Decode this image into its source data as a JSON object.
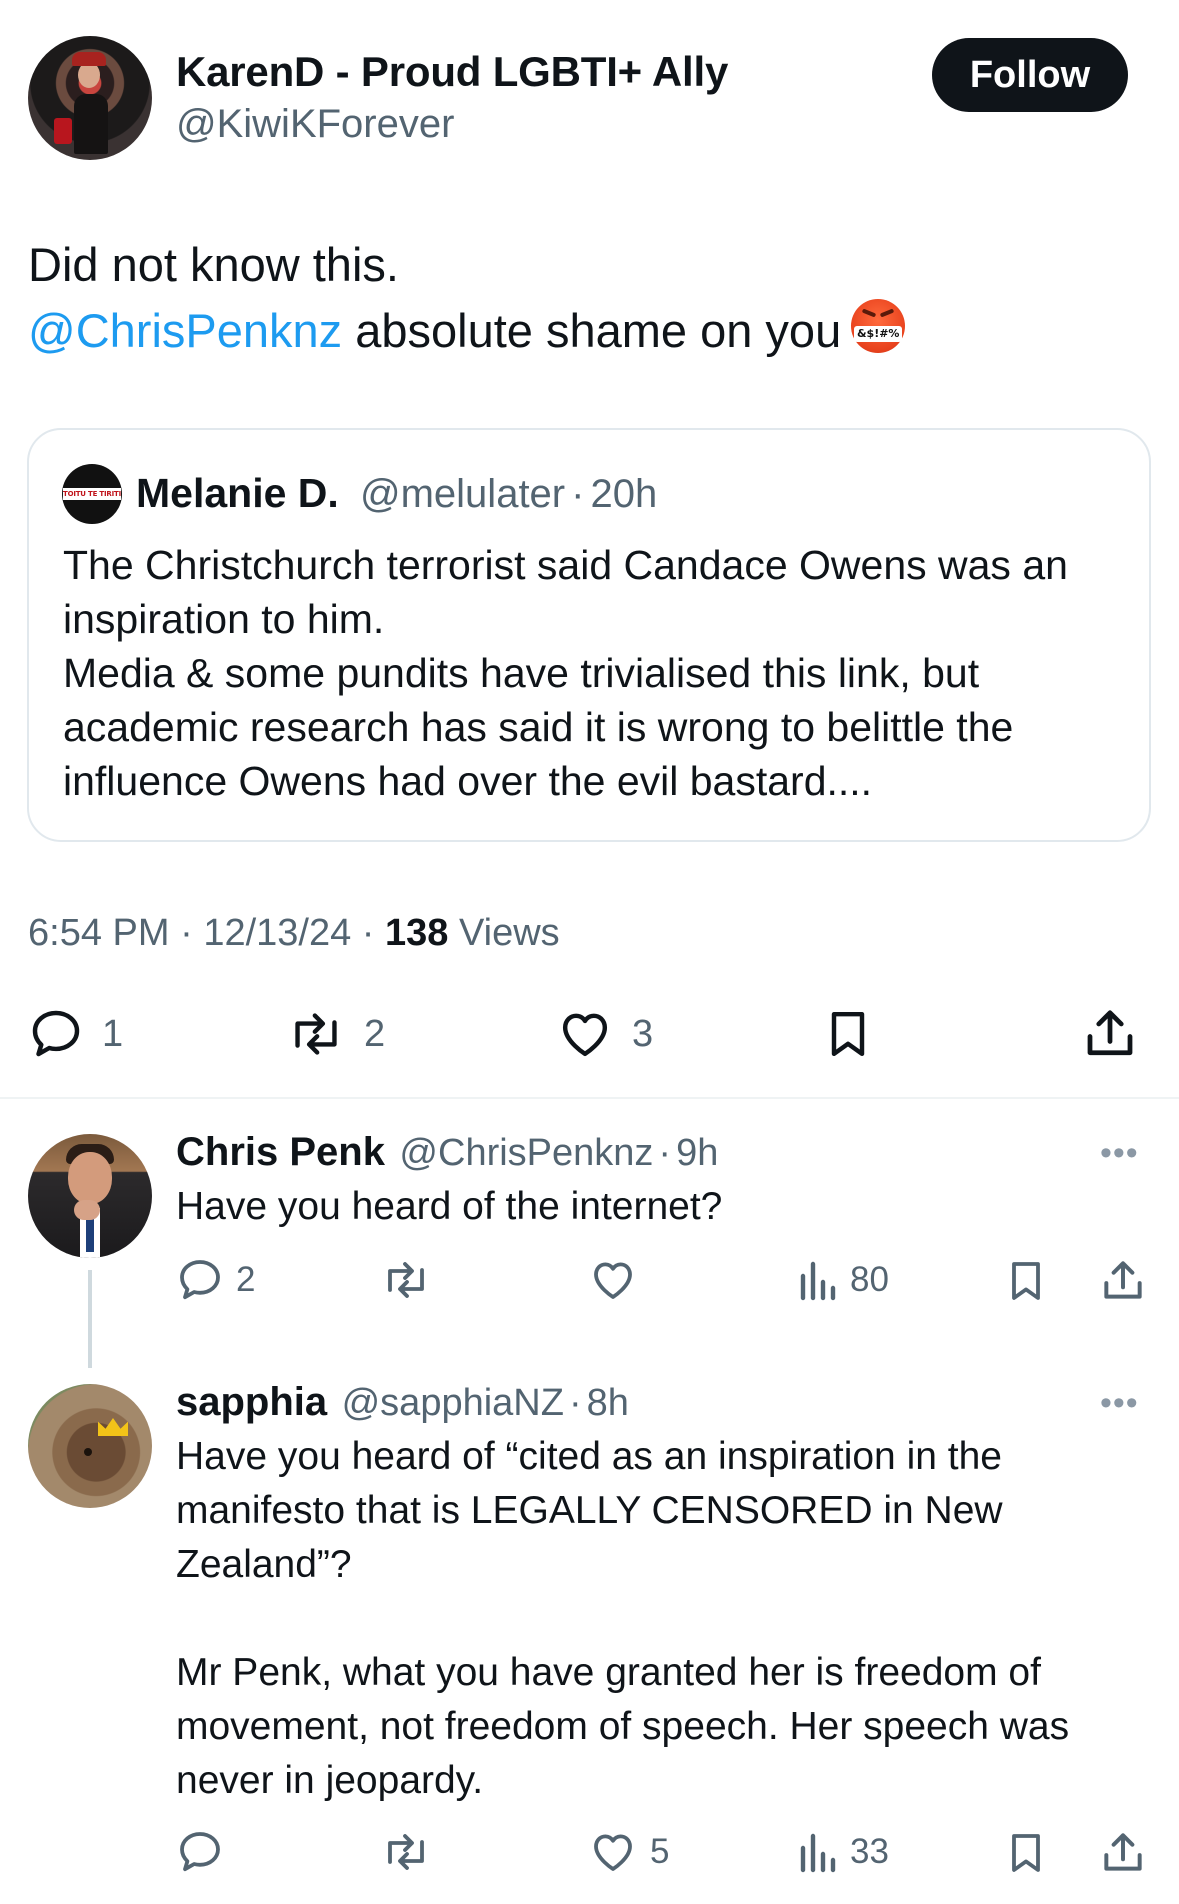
{
  "main_tweet": {
    "author": {
      "display_name": "KarenD - Proud LGBTI+ Ally",
      "handle": "@KiwiKForever",
      "avatar_icon": "profile-photo"
    },
    "follow_label": "Follow",
    "text_line1": "Did not know this.",
    "mention": "@ChrisPenknz",
    "text_line2_rest": " absolute shame on you",
    "emoji": "face-with-symbols-on-mouth",
    "emoji_text": "&$!#%",
    "quoted": {
      "author": "Melanie D.",
      "handle": "@melulater",
      "separator": "·",
      "age": "20h",
      "avatar_label": "TOITU TE TIRITI",
      "text": "The Christchurch terrorist said Candace Owens was an inspiration to him.\nMedia & some pundits have trivialised this link, but academic research has said it is wrong to belittle the influence Owens had over the evil bastard...."
    },
    "time": "6:54 PM",
    "date": "12/13/24",
    "separator": "·",
    "views_count": "138",
    "views_label": "Views",
    "actions": {
      "replies": "1",
      "reposts": "2",
      "likes": "3"
    }
  },
  "replies": [
    {
      "display_name": "Chris Penk",
      "handle": "@ChrisPenknz",
      "separator": "·",
      "age": "9h",
      "text": "Have you heard of the internet?",
      "actions": {
        "replies": "2",
        "reposts": "",
        "likes": "",
        "views": "80"
      }
    },
    {
      "display_name": "sapphia",
      "handle": "@sapphiaNZ",
      "separator": "·",
      "age": "8h",
      "text": "Have you heard of “cited as an inspiration in the manifesto that is LEGALLY CENSORED in New Zealand”?\n\nMr Penk, what you have granted her is freedom of movement, not freedom of speech. Her speech was never in jeopardy.",
      "actions": {
        "replies": "",
        "reposts": "",
        "likes": "5",
        "views": "33"
      }
    }
  ],
  "colors": {
    "accent": "#1d9bf0",
    "text": "#0f1419",
    "secondary": "#536471",
    "border": "#e1e8ed"
  }
}
